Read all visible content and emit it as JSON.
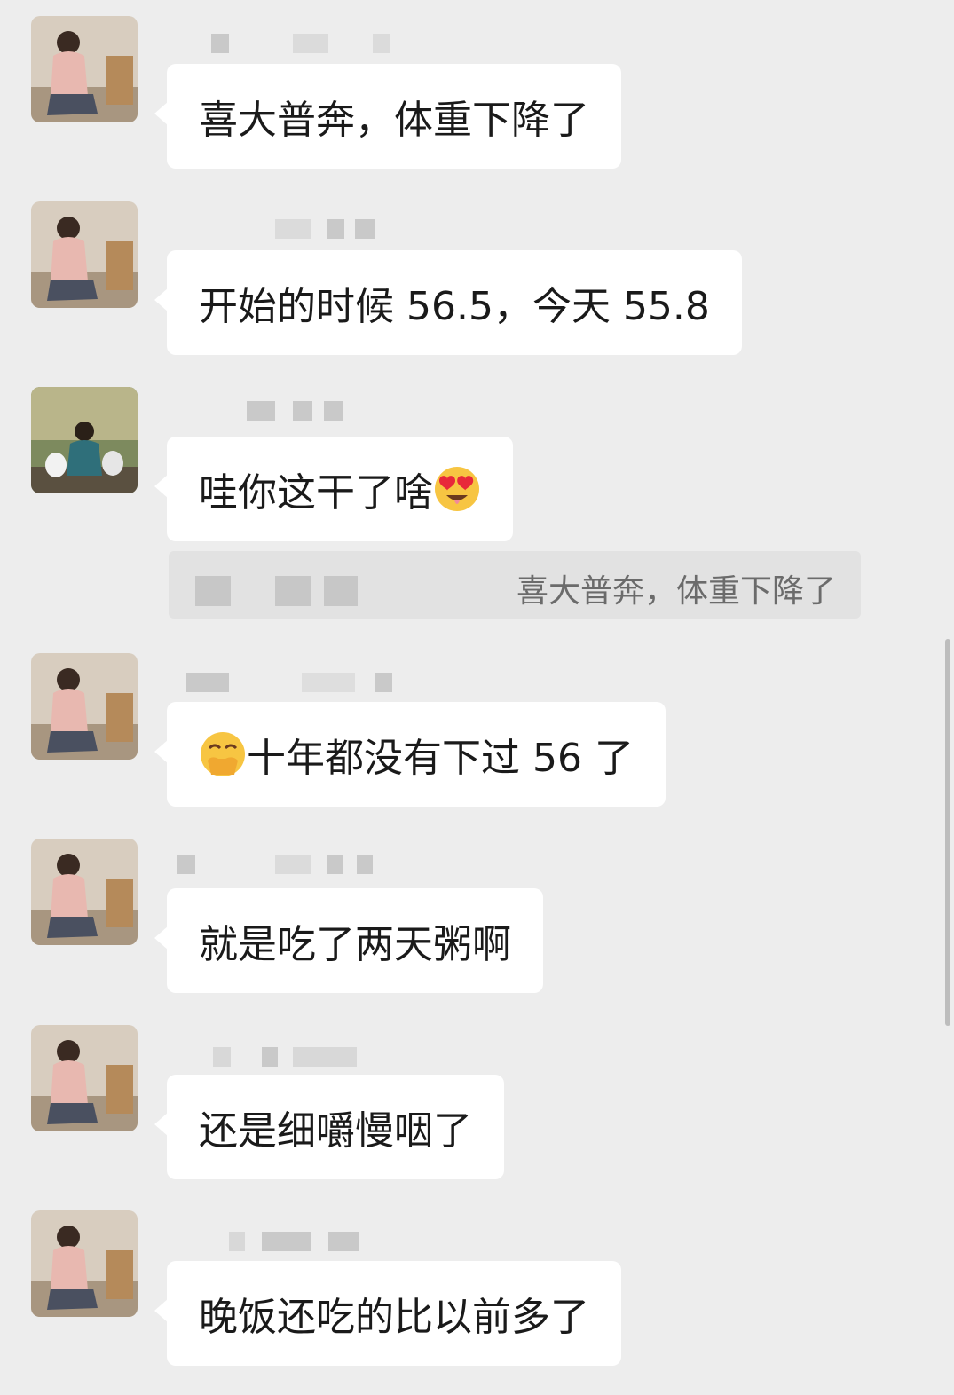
{
  "messages": [
    {
      "text": "喜大普奔，体重下降了",
      "avatar": "woman-portrait"
    },
    {
      "text": "开始的时候 56.5，今天 55.8",
      "avatar": "woman-portrait"
    },
    {
      "text": "哇你这干了啥",
      "avatar": "woman-with-dogs",
      "emoji_after": "heart-eyes-emoji"
    },
    {
      "text": "十年都没有下过 56 了",
      "avatar": "woman-portrait",
      "emoji_before": "hand-over-mouth-emoji"
    },
    {
      "text": "就是吃了两天粥啊",
      "avatar": "woman-portrait"
    },
    {
      "text": "还是细嚼慢咽了",
      "avatar": "woman-portrait"
    },
    {
      "text": "晚饭还吃的比以前多了",
      "avatar": "woman-portrait"
    }
  ],
  "quote": {
    "text": "喜大普奔，体重下降了"
  },
  "colors": {
    "background": "#ededed",
    "bubble": "#ffffff",
    "quote_bg": "#e2e2e2",
    "text": "#1a1a1a"
  }
}
